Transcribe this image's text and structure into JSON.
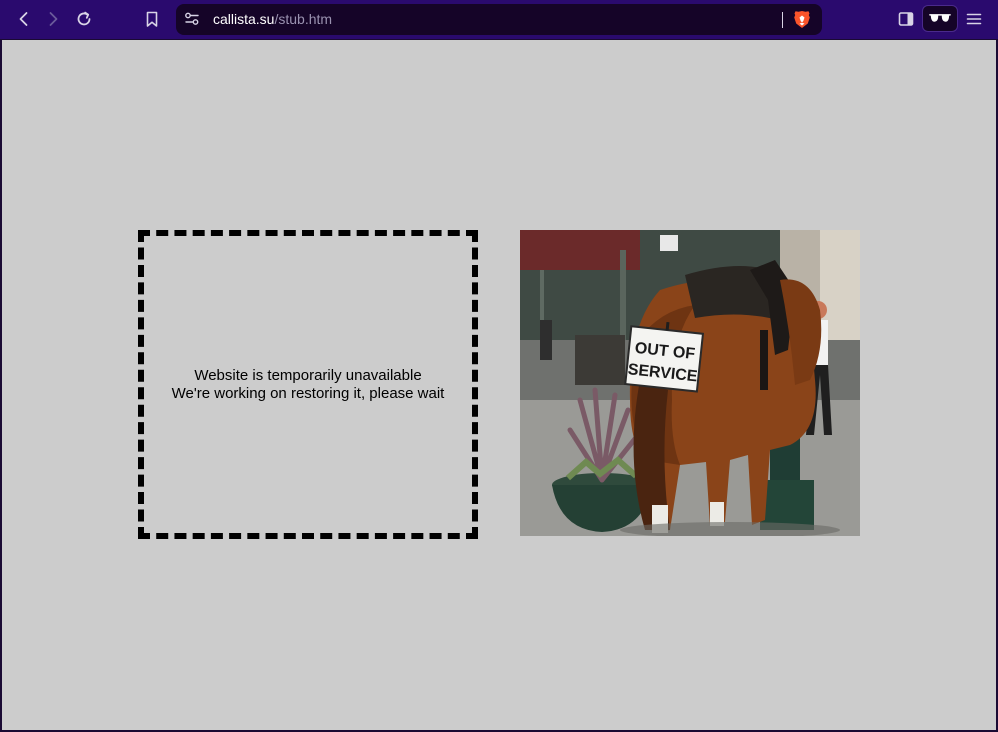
{
  "browser": {
    "url_host": "callista.su",
    "url_path": "/stub.htm",
    "colors": {
      "toolbar": "#2a0a6e",
      "address_bar": "#150428",
      "icon": "#d8d4e6"
    }
  },
  "page": {
    "background": "#cccccc",
    "message_line1": "Website is temporarily unavailable",
    "message_line2": "We're working on restoring it, please wait",
    "image": {
      "sign_line1": "OUT OF",
      "sign_line2": "SERVICE"
    }
  }
}
